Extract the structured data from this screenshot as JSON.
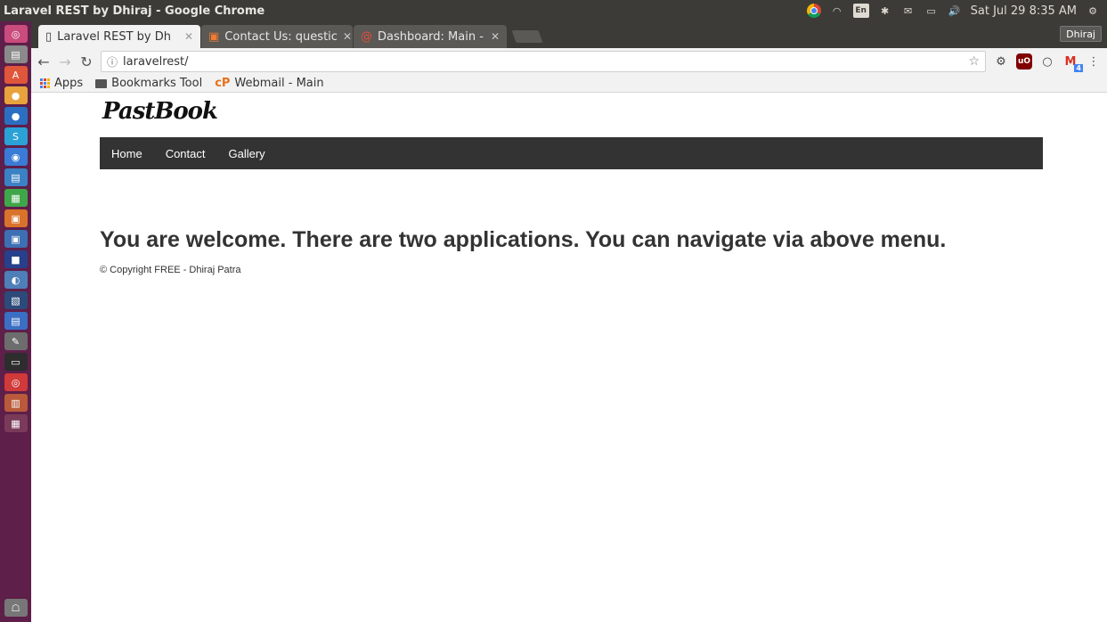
{
  "os": {
    "window_title": "Laravel REST by Dhiraj - Google Chrome",
    "clock": "Sat Jul 29  8:35 AM",
    "keyboard": "En"
  },
  "browser": {
    "tabs": [
      {
        "label": "Laravel REST by Dh",
        "active": true
      },
      {
        "label": "Contact Us: questic",
        "active": false
      },
      {
        "label": "Dashboard: Main - ",
        "active": false
      }
    ],
    "profile": "Dhiraj",
    "url": "laravelrest/",
    "bookmarks": [
      {
        "label": "Apps"
      },
      {
        "label": "Bookmarks Tool"
      },
      {
        "label": "Webmail - Main"
      }
    ]
  },
  "page": {
    "brand": "PastBook",
    "nav": [
      "Home",
      "Contact",
      "Gallery"
    ],
    "welcome": "You are welcome. There are two applications. You can navigate via above menu.",
    "copyright": "© Copyright FREE - Dhiraj Patra"
  },
  "extensions": {
    "gmail_count": "4"
  },
  "colors": {
    "navbar": "#333333",
    "launcher": "#5e1f4a",
    "titlebar": "#3c3b37"
  }
}
